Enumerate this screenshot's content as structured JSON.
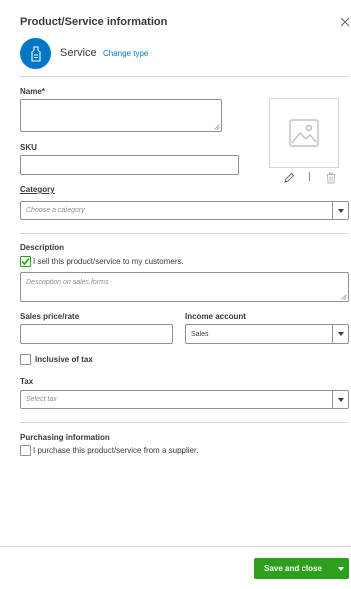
{
  "header": {
    "title": "Product/Service information",
    "type_label": "Service",
    "change_type": "Change type"
  },
  "fields": {
    "name_label": "Name*",
    "sku_label": "SKU",
    "category_label": "Category",
    "category_placeholder": "Choose a category",
    "description_label": "Description",
    "sell_checkbox_label": "I sell this product/service to my customers.",
    "sell_checked": true,
    "description_placeholder": "Description on sales forms",
    "sales_price_label": "Sales price/rate",
    "income_account_label": "Income account",
    "income_account_value": "Sales",
    "inclusive_tax_label": "Inclusive of tax",
    "inclusive_tax_checked": false,
    "tax_label": "Tax",
    "tax_placeholder": "Select tax",
    "purchasing_label": "Purchasing information",
    "purchase_checkbox_label": "I purchase this product/service from a supplier.",
    "purchase_checked": false
  },
  "footer": {
    "save_label": "Save and close"
  },
  "colors": {
    "accent": "#0077c5",
    "primary_button": "#2ca01c",
    "text": "#393a3d",
    "border": "#8d9096"
  }
}
